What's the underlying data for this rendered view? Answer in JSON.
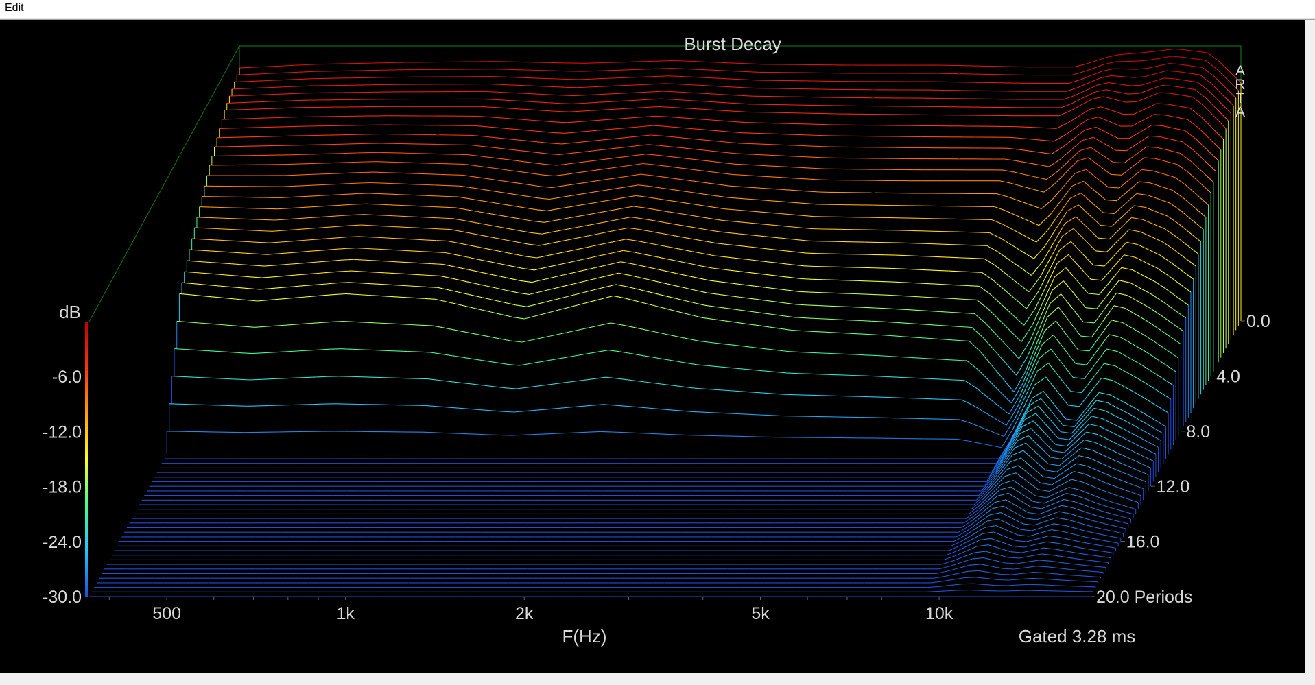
{
  "menu": {
    "edit": "Edit"
  },
  "chart_data": {
    "type": "line",
    "title": "Burst Decay",
    "watermark": "ARTA",
    "xlabel": "F(Hz)",
    "x_scale": "log",
    "xlim": [
      370,
      18000
    ],
    "x_ticks": [
      {
        "value": 500,
        "label": "500"
      },
      {
        "value": 1000,
        "label": "1k"
      },
      {
        "value": 2000,
        "label": "2k"
      },
      {
        "value": 5000,
        "label": "5k"
      },
      {
        "value": 10000,
        "label": "10k"
      }
    ],
    "zlabel": "dB",
    "zlim": [
      -30,
      0
    ],
    "z_ticks": [
      {
        "value": 0,
        "label": ""
      },
      {
        "value": -6,
        "label": "-6.0"
      },
      {
        "value": -12,
        "label": "-12.0"
      },
      {
        "value": -18,
        "label": "-18.0"
      },
      {
        "value": -24,
        "label": "-24.0"
      },
      {
        "value": -30,
        "label": "-30.0"
      }
    ],
    "ylabel": "Periods",
    "ylim": [
      0,
      20
    ],
    "y_ticks": [
      {
        "value": 0,
        "label": "0.0"
      },
      {
        "value": 4,
        "label": "4.0"
      },
      {
        "value": 8,
        "label": "8.0"
      },
      {
        "value": 12,
        "label": "12.0"
      },
      {
        "value": 16,
        "label": "16.0"
      },
      {
        "value": 20,
        "label": "20.0 Periods"
      }
    ],
    "note": "Gated 3.28 ms",
    "colormap": [
      "#1f4fd8",
      "#1fc8ff",
      "#40ff90",
      "#ffff20",
      "#ffa000",
      "#ff3010",
      "#c00000"
    ],
    "series": [
      {
        "periods": 0,
        "freq_hz": [
          370,
          500,
          700,
          1000,
          1400,
          2000,
          2800,
          4000,
          5600,
          8000,
          9500,
          11000,
          12500,
          14000,
          16000,
          18000
        ],
        "level_db": [
          -2.4,
          -2.0,
          -1.8,
          -1.7,
          -1.9,
          -1.6,
          -2.0,
          -2.1,
          -2.1,
          -2.3,
          -2.3,
          -1.0,
          -0.7,
          -0.3,
          -0.8,
          -4.0
        ]
      },
      {
        "periods": 2,
        "freq_hz": [
          370,
          500,
          700,
          1000,
          1400,
          2000,
          2800,
          4000,
          5600,
          8000,
          9500,
          11000,
          12500,
          14000,
          16000,
          18000
        ],
        "level_db": [
          -4.0,
          -3.7,
          -3.6,
          -3.6,
          -4.2,
          -3.6,
          -4.2,
          -4.4,
          -4.5,
          -4.6,
          -4.6,
          -2.4,
          -3.3,
          -2.0,
          -2.6,
          -6.0
        ]
      },
      {
        "periods": 4,
        "freq_hz": [
          370,
          500,
          700,
          1000,
          1400,
          2000,
          2800,
          4000,
          5600,
          8000,
          9500,
          11000,
          12500,
          14000,
          16000,
          18000
        ],
        "level_db": [
          -7.0,
          -6.9,
          -6.6,
          -6.9,
          -8.2,
          -6.8,
          -8.0,
          -8.6,
          -8.7,
          -8.7,
          -10.0,
          -5.8,
          -8.5,
          -6.0,
          -7.0,
          -10.0
        ]
      },
      {
        "periods": 6,
        "freq_hz": [
          370,
          500,
          700,
          1000,
          1400,
          2000,
          2800,
          4000,
          5600,
          8000,
          9500,
          11000,
          12500,
          14000,
          16000,
          18000
        ],
        "level_db": [
          -10.8,
          -11.2,
          -10.5,
          -11.0,
          -12.8,
          -10.8,
          -12.5,
          -13.6,
          -13.8,
          -14.2,
          -18.0,
          -10.4,
          -14.0,
          -10.8,
          -12.5,
          -15.0
        ]
      },
      {
        "periods": 8,
        "freq_hz": [
          370,
          500,
          700,
          1000,
          1400,
          2000,
          2800,
          4000,
          5600,
          8000,
          9500,
          11000,
          12500,
          14000,
          16000,
          18000
        ],
        "level_db": [
          -15.0,
          -15.8,
          -15.0,
          -15.6,
          -17.8,
          -15.2,
          -17.6,
          -19.0,
          -19.5,
          -20.2,
          -26.0,
          -15.8,
          -20.5,
          -16.0,
          -18.2,
          -20.5
        ]
      },
      {
        "periods": 10,
        "freq_hz": [
          370,
          500,
          700,
          1000,
          1400,
          2000,
          2800,
          4000,
          5600,
          8000,
          9500,
          11000,
          12500,
          14000,
          16000,
          18000
        ],
        "level_db": [
          -30,
          -30,
          -30,
          -30,
          -30,
          -30,
          -30,
          -30,
          -30,
          -30,
          -30,
          -22.0,
          -26.5,
          -22.5,
          -24.5,
          -26.5
        ]
      },
      {
        "periods": 14,
        "freq_hz": [
          370,
          500,
          700,
          1000,
          1400,
          2000,
          2800,
          4000,
          5600,
          8000,
          9500,
          11000,
          12500,
          14000,
          16000,
          18000
        ],
        "level_db": [
          -30,
          -30,
          -30,
          -30,
          -30,
          -30,
          -30,
          -30,
          -30,
          -30,
          -30,
          -26.0,
          -28.5,
          -27.0,
          -28.5,
          -29.5
        ]
      },
      {
        "periods": 20,
        "freq_hz": [
          370,
          500,
          700,
          1000,
          1400,
          2000,
          2800,
          4000,
          5600,
          8000,
          9500,
          11000,
          12500,
          14000,
          16000,
          18000
        ],
        "level_db": [
          -30,
          -30,
          -30,
          -30,
          -30,
          -30,
          -30,
          -30,
          -30,
          -30,
          -30,
          -30,
          -30,
          -30,
          -30,
          -30
        ]
      }
    ]
  }
}
